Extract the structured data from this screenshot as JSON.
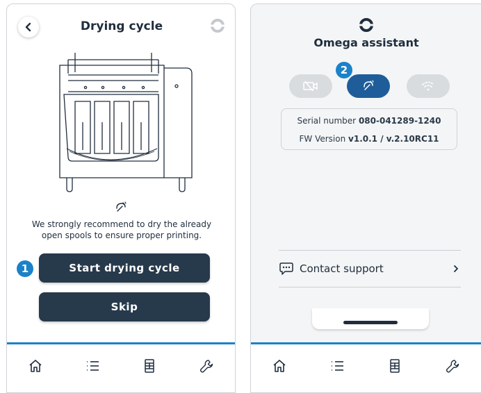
{
  "left_screen": {
    "title": "Drying cycle",
    "recommendation_line1": "We strongly recommend to dry the already",
    "recommendation_line2": "open spools to ensure proper printing.",
    "start_button_label": "Start drying cycle",
    "skip_button_label": "Skip",
    "step_badge": "1"
  },
  "right_screen": {
    "title": "Omega assistant",
    "step_badge": "2",
    "serial_label": "Serial number",
    "serial_value": "080-041289-1240",
    "fw_label": "FW Version",
    "fw_value": "v1.0.1 / v.2.10RC11",
    "contact_support_label": "Contact support"
  },
  "tabbar": {
    "items": [
      "home-icon",
      "list-icon",
      "device-icon",
      "wrench-icon"
    ]
  },
  "colors": {
    "accent": "#1b82c9",
    "button_dark": "#273a4c",
    "active_pill": "#1e5d9a"
  }
}
